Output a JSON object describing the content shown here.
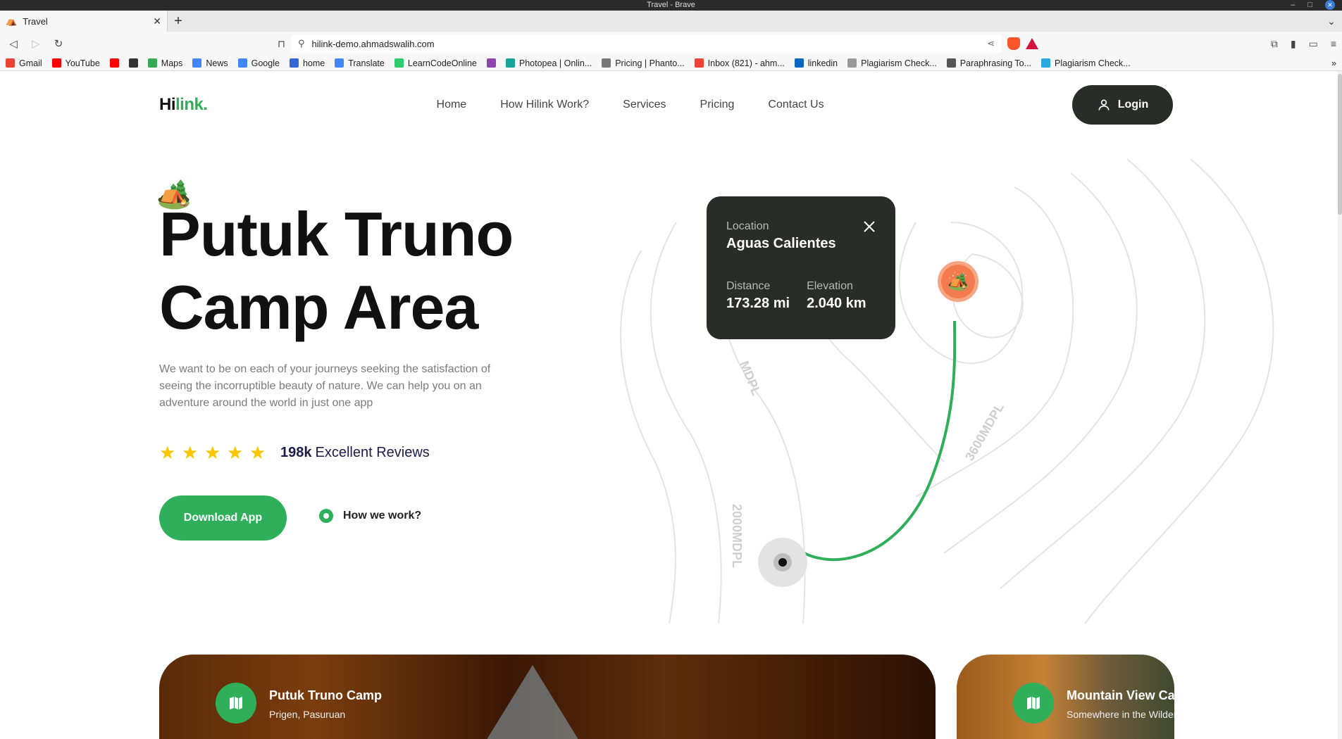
{
  "os": {
    "window_title": "Travel - Brave"
  },
  "browser": {
    "tab": {
      "title": "Travel"
    },
    "url": "hilink-demo.ahmadswalih.com",
    "bookmarks": [
      {
        "label": "Gmail",
        "color": "#ea4335"
      },
      {
        "label": "YouTube",
        "color": "#ff0000"
      },
      {
        "label": "",
        "color": "#ff0000"
      },
      {
        "label": "",
        "color": "#333333"
      },
      {
        "label": "Maps",
        "color": "#34a853"
      },
      {
        "label": "News",
        "color": "#4285f4"
      },
      {
        "label": "Google",
        "color": "#4285f4"
      },
      {
        "label": "home",
        "color": "#3367d6"
      },
      {
        "label": "Translate",
        "color": "#4285f4"
      },
      {
        "label": "LearnCodeOnline",
        "color": "#2ecc71"
      },
      {
        "label": "",
        "color": "#8e44ad"
      },
      {
        "label": "Photopea | Onlin...",
        "color": "#18a497"
      },
      {
        "label": "Pricing | Phanto...",
        "color": "#777777"
      },
      {
        "label": "Inbox (821) - ahm...",
        "color": "#ea4335"
      },
      {
        "label": "linkedin",
        "color": "#0a66c2"
      },
      {
        "label": "Plagiarism Check...",
        "color": "#999999"
      },
      {
        "label": "Paraphrasing To...",
        "color": "#555555"
      },
      {
        "label": "Plagiarism Check...",
        "color": "#2aa8e0"
      }
    ],
    "bookmarks_more": "»"
  },
  "site": {
    "logo": {
      "prefix": "Hi",
      "accent": "link."
    },
    "nav": [
      "Home",
      "How Hilink Work?",
      "Services",
      "Pricing",
      "Contact Us"
    ],
    "login_label": "Login",
    "accent_color": "#30af5b",
    "dark_color": "#292c27"
  },
  "hero": {
    "emoji": "🏕️",
    "title_line1": "Putuk Truno",
    "title_line2": "Camp Area",
    "description": "We want to be on each of your journeys seeking the satisfaction of seeing the incorruptible beauty of nature. We can help you on an adventure around the world in just one app",
    "rating_stars": 5,
    "review_count": "198k",
    "review_label": "Excellent Reviews",
    "download_label": "Download App",
    "how_label": "How we work?"
  },
  "map": {
    "card": {
      "location_label": "Location",
      "location_value": "Aguas Calientes",
      "distance_label": "Distance",
      "distance_value": "173.28 mi",
      "elevation_label": "Elevation",
      "elevation_value": "2.040 km"
    },
    "contour_labels": [
      "MDPL",
      "3600MDPL",
      "2000MDPL"
    ],
    "pin_emoji": "🏕️"
  },
  "cards": [
    {
      "title": "Putuk Truno Camp",
      "subtitle": "Prigen, Pasuruan"
    },
    {
      "title": "Mountain View Camp",
      "subtitle": "Somewhere in the Wilderness"
    }
  ]
}
